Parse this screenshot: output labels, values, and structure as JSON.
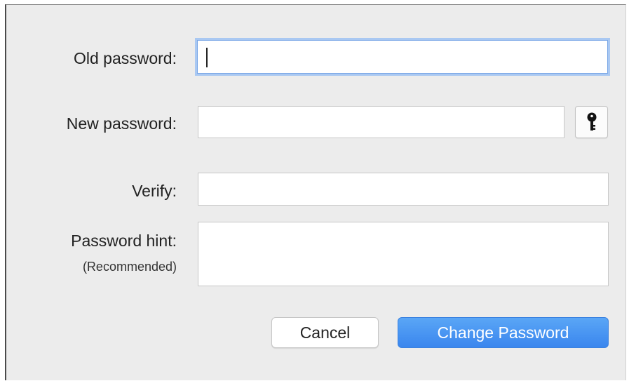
{
  "form": {
    "old_password_label": "Old password:",
    "old_password_value": "",
    "new_password_label": "New password:",
    "new_password_value": "",
    "verify_label": "Verify:",
    "verify_value": "",
    "hint_label": "Password hint:",
    "hint_sublabel": "(Recommended)",
    "hint_value": ""
  },
  "buttons": {
    "cancel_label": "Cancel",
    "change_label": "Change Password"
  },
  "icons": {
    "password_assistant": "key-icon"
  },
  "colors": {
    "dialog_bg": "#ececec",
    "focus_ring": "#a9c8f2",
    "primary_button": "#3a86ee",
    "primary_text": "#ffffff"
  }
}
